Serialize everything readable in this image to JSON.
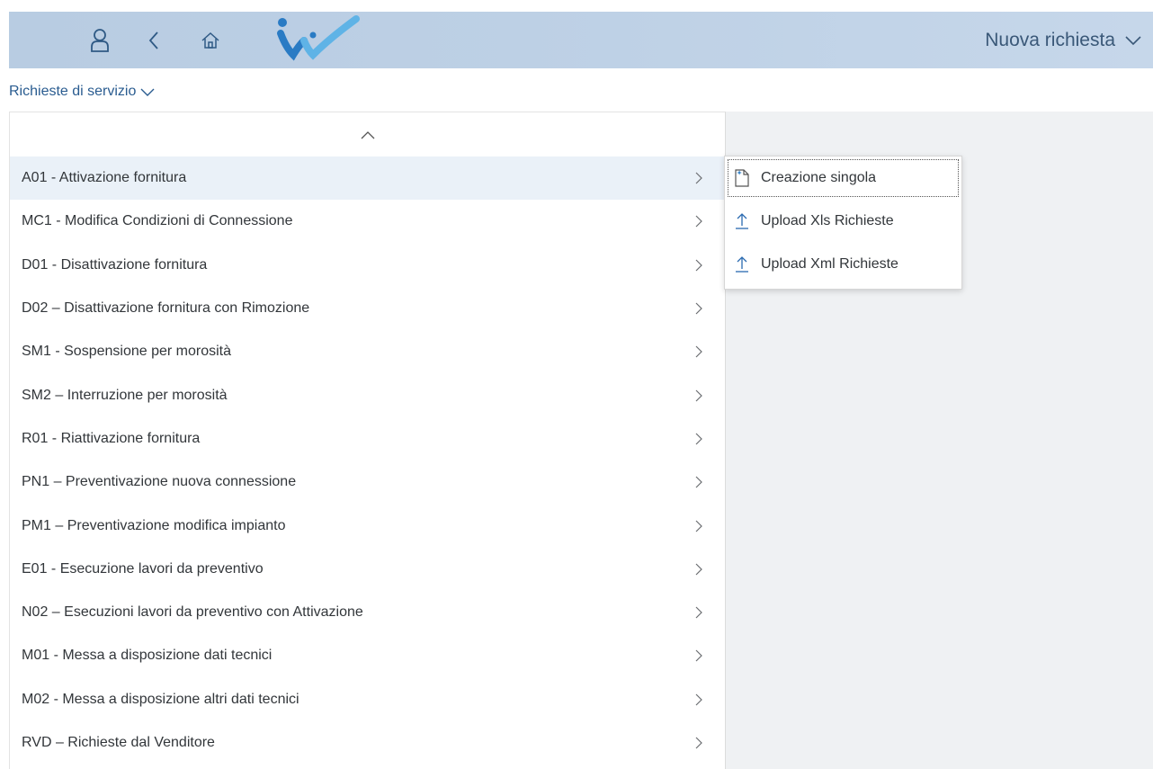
{
  "shell": {
    "title": "Nuova richiesta",
    "icons": [
      "user-icon",
      "back-icon",
      "home-icon"
    ],
    "logo_colors": [
      "#2a7bc4",
      "#5fb3e6"
    ],
    "background": "#bdd0e5"
  },
  "sub_header": {
    "label": "Richieste di servizio"
  },
  "menu": {
    "items": [
      {
        "label": "A01 - Attivazione fornitura",
        "active": true
      },
      {
        "label": "MC1 - Modifica Condizioni di Connessione"
      },
      {
        "label": "D01 - Disattivazione fornitura"
      },
      {
        "label": "D02 – Disattivazione fornitura con Rimozione"
      },
      {
        "label": "SM1 - Sospensione per morosità"
      },
      {
        "label": "SM2 – Interruzione per morosità"
      },
      {
        "label": "R01 - Riattivazione fornitura"
      },
      {
        "label": "PN1 – Preventivazione nuova connessione"
      },
      {
        "label": "PM1 – Preventivazione modifica impianto"
      },
      {
        "label": "E01 - Esecuzione lavori da preventivo"
      },
      {
        "label": "N02 – Esecuzioni lavori da preventivo con Attivazione"
      },
      {
        "label": "M01 - Messa a disposizione dati tecnici"
      },
      {
        "label": "M02 - Messa a disposizione altri dati tecnici"
      },
      {
        "label": "RVD – Richieste dal Venditore"
      }
    ]
  },
  "submenu": {
    "items": [
      {
        "label": "Creazione singola",
        "icon": "new-document-icon"
      },
      {
        "label": "Upload Xls Richieste",
        "icon": "upload-icon"
      },
      {
        "label": "Upload Xml Richieste",
        "icon": "upload-icon"
      }
    ]
  }
}
